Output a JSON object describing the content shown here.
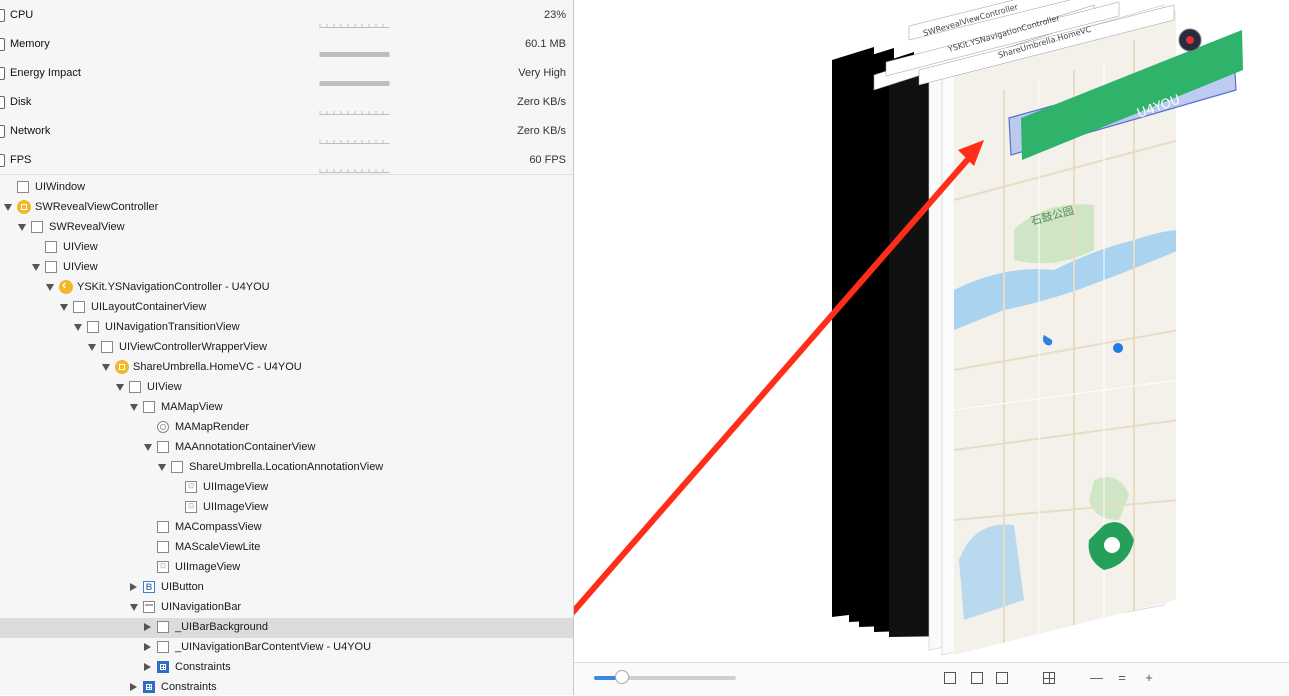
{
  "gauges": [
    {
      "label": "CPU",
      "value": "23%"
    },
    {
      "label": "Memory",
      "value": "60.1 MB"
    },
    {
      "label": "Energy Impact",
      "value": "Very High"
    },
    {
      "label": "Disk",
      "value": "Zero KB/s"
    },
    {
      "label": "Network",
      "value": "Zero KB/s"
    },
    {
      "label": "FPS",
      "value": "60 FPS"
    }
  ],
  "tree": [
    {
      "label": "UIWindow",
      "depth": 0,
      "expander": "none",
      "icon": "view"
    },
    {
      "label": "SWRevealViewController",
      "depth": 0,
      "expander": "down",
      "icon": "vc"
    },
    {
      "label": "SWRevealView",
      "depth": 1,
      "expander": "down",
      "icon": "view"
    },
    {
      "label": "UIView",
      "depth": 2,
      "expander": "none",
      "icon": "view"
    },
    {
      "label": "UIView",
      "depth": 2,
      "expander": "down",
      "icon": "view"
    },
    {
      "label": "YSKit.YSNavigationController - U4YOU",
      "depth": 3,
      "expander": "down",
      "icon": "nav"
    },
    {
      "label": "UILayoutContainerView",
      "depth": 4,
      "expander": "down",
      "icon": "view"
    },
    {
      "label": "UINavigationTransitionView",
      "depth": 5,
      "expander": "down",
      "icon": "view"
    },
    {
      "label": "UIViewControllerWrapperView",
      "depth": 6,
      "expander": "down",
      "icon": "view"
    },
    {
      "label": "ShareUmbrella.HomeVC - U4YOU",
      "depth": 7,
      "expander": "down",
      "icon": "vc"
    },
    {
      "label": "UIView",
      "depth": 8,
      "expander": "down",
      "icon": "view"
    },
    {
      "label": "MAMapView",
      "depth": 9,
      "expander": "down",
      "icon": "view"
    },
    {
      "label": "MAMapRender",
      "depth": 10,
      "expander": "none",
      "icon": "render"
    },
    {
      "label": "MAAnnotationContainerView",
      "depth": 10,
      "expander": "down",
      "icon": "view"
    },
    {
      "label": "ShareUmbrella.LocationAnnotationView",
      "depth": 11,
      "expander": "down",
      "icon": "view"
    },
    {
      "label": "UIImageView",
      "depth": 12,
      "expander": "none",
      "icon": "img"
    },
    {
      "label": "UIImageView",
      "depth": 12,
      "expander": "none",
      "icon": "img"
    },
    {
      "label": "MACompassView",
      "depth": 10,
      "expander": "none",
      "icon": "view"
    },
    {
      "label": "MAScaleViewLite",
      "depth": 10,
      "expander": "none",
      "icon": "view"
    },
    {
      "label": "UIImageView",
      "depth": 10,
      "expander": "none",
      "icon": "img"
    },
    {
      "label": "UIButton",
      "depth": 9,
      "expander": "right",
      "icon": "btn"
    },
    {
      "label": "UINavigationBar",
      "depth": 9,
      "expander": "down",
      "icon": "bar"
    },
    {
      "label": "_UIBarBackground",
      "depth": 10,
      "expander": "right",
      "icon": "view",
      "selected": true
    },
    {
      "label": "_UINavigationBarContentView - U4YOU",
      "depth": 10,
      "expander": "right",
      "icon": "view"
    },
    {
      "label": "Constraints",
      "depth": 10,
      "expander": "right",
      "icon": "cons"
    },
    {
      "label": "Constraints",
      "depth": 9,
      "expander": "right",
      "icon": "cons"
    }
  ],
  "canvas": {
    "layer_titles": [
      "SWRevealViewController",
      "YSKit.YSNavigationController",
      "ShareUmbrella.HomeVC"
    ],
    "nav_title": "U4YOU",
    "map_labels": [
      "石鼓公园"
    ],
    "highlight_color": "#2fb36b",
    "arrow_color": "#ff2d1a"
  },
  "toolbar": {
    "slider_value": 0.2
  }
}
